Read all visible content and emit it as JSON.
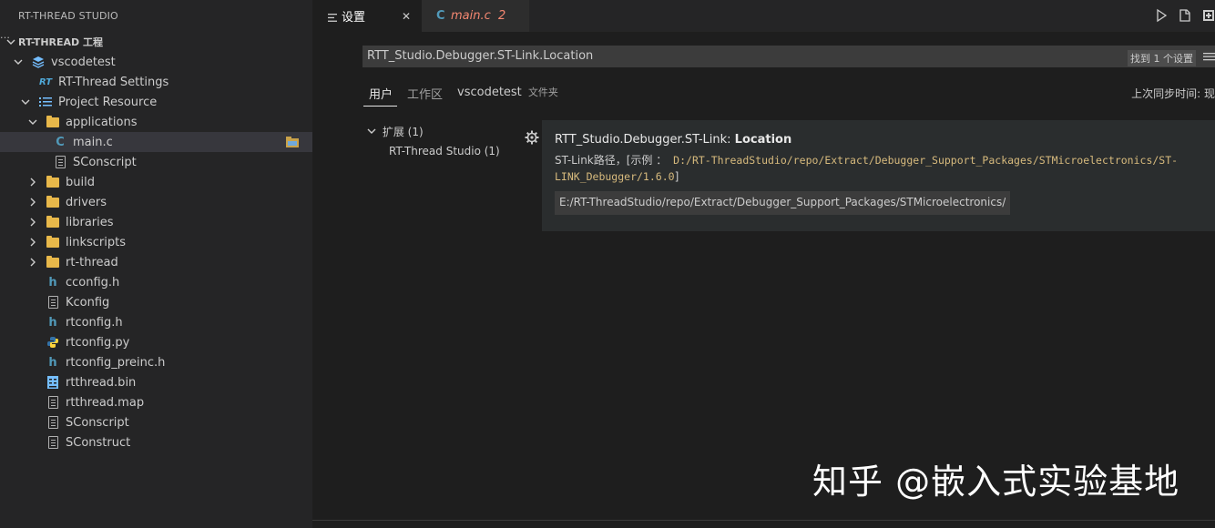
{
  "sidebar": {
    "header": "RT-THREAD STUDIO",
    "more": "···",
    "project_root": "RT-THREAD 工程",
    "items": [
      {
        "label": "vscodetest"
      },
      {
        "label": "RT-Thread Settings"
      },
      {
        "label": "Project Resource"
      },
      {
        "label": "applications"
      },
      {
        "label": "main.c"
      },
      {
        "label": "SConscript"
      },
      {
        "label": "build"
      },
      {
        "label": "drivers"
      },
      {
        "label": "libraries"
      },
      {
        "label": "linkscripts"
      },
      {
        "label": "rt-thread"
      },
      {
        "label": "cconfig.h"
      },
      {
        "label": "Kconfig"
      },
      {
        "label": "rtconfig.h"
      },
      {
        "label": "rtconfig.py"
      },
      {
        "label": "rtconfig_preinc.h"
      },
      {
        "label": "rtthread.bin"
      },
      {
        "label": "rtthread.map"
      },
      {
        "label": "SConscript"
      },
      {
        "label": "SConstruct"
      }
    ]
  },
  "tabs": [
    {
      "label": "设置",
      "close": "✕"
    },
    {
      "label": "main.c",
      "badge": "2"
    }
  ],
  "settings": {
    "search_value": "RTT_Studio.Debugger.ST-Link.Location",
    "result_count": "找到 1 个设置",
    "scopes": {
      "user": "用户",
      "workspace": "工作区",
      "folder": "vscodetest",
      "folder_suffix": "文件夹"
    },
    "sync": "上次同步时间: 现",
    "toc": {
      "extensions": "扩展 (1)",
      "rtthread": "RT-Thread Studio (1)"
    },
    "item": {
      "title_prefix": "RTT_Studio.Debugger.ST-Link: ",
      "title_name": "Location",
      "desc_text": "ST-Link路径，[示例 ：",
      "desc_code": " D:/RT-ThreadStudio/repo/Extract/Debugger_Support_Packages/STMicroelectronics/ST-LINK_Debugger/1.6.0",
      "desc_end": "]",
      "value": "E:/RT-ThreadStudio/repo/Extract/Debugger_Support_Packages/STMicroelectronics/..."
    }
  },
  "watermark": "知乎 @嵌入式实验基地",
  "colors": {
    "accent": "#3794ff",
    "tab_modified": "#f48771",
    "folder": "#e8b84a"
  }
}
